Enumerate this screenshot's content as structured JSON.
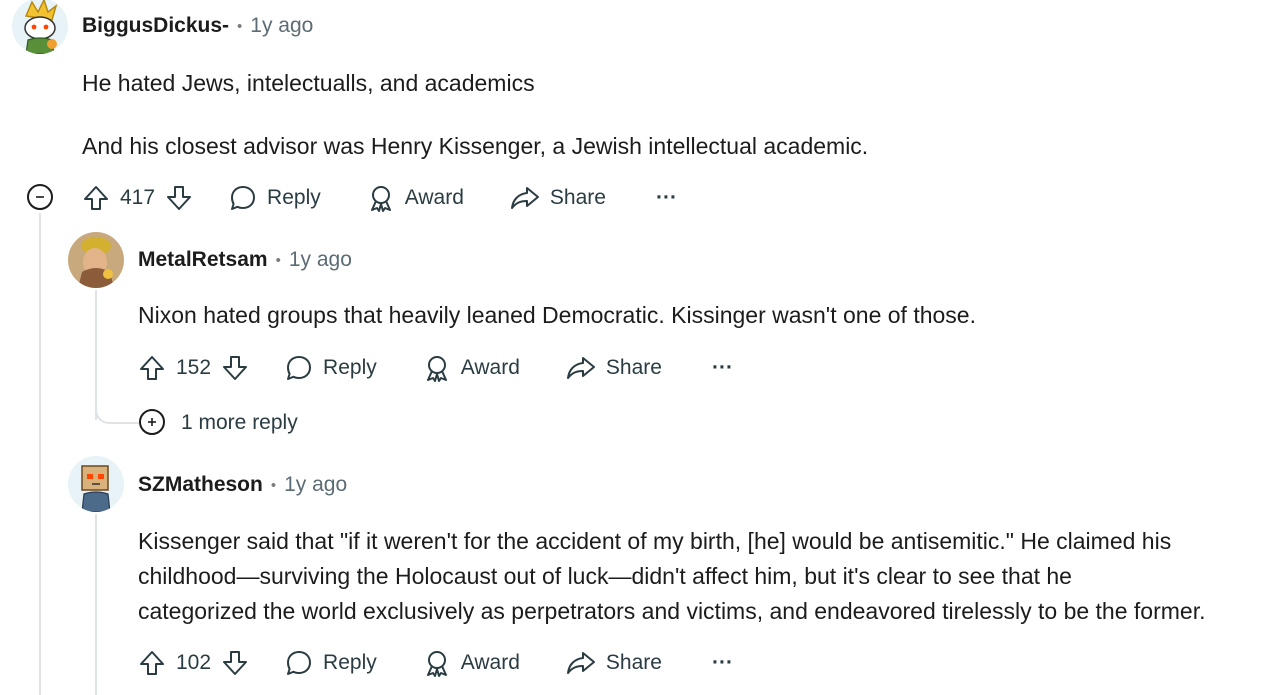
{
  "comments": [
    {
      "author": "BiggusDickus-",
      "time": "1y ago",
      "body": [
        "He hated Jews, intelectualls, and academics",
        "And his closest advisor was Henry Kissenger, a Jewish intellectual academic."
      ],
      "votes": "417",
      "reply_label": "Reply",
      "award_label": "Award",
      "share_label": "Share",
      "more_label": "···"
    },
    {
      "author": "MetalRetsam",
      "time": "1y ago",
      "body": [
        "Nixon hated groups that heavily leaned Democratic. Kissinger wasn't one of those."
      ],
      "votes": "152",
      "reply_label": "Reply",
      "award_label": "Award",
      "share_label": "Share",
      "more_label": "···",
      "more_replies": "1 more reply"
    },
    {
      "author": "SZMatheson",
      "time": "1y ago",
      "body": [
        "Kissenger said that \"if it weren't for the accident of my birth, [he] would be antisemitic.\" He claimed his",
        "childhood—surviving the Holocaust out of luck—didn't affect him, but it's clear to see that he",
        "categorized the world exclusively as perpetrators and victims, and endeavored tirelessly to be the former."
      ],
      "votes": "102",
      "reply_label": "Reply",
      "award_label": "Award",
      "share_label": "Share",
      "more_label": "···"
    }
  ],
  "separator": "•",
  "colors": {
    "thread_line": "#dfe3e6",
    "meta_text": "#5c6c74",
    "action_text": "#2a3c42"
  }
}
